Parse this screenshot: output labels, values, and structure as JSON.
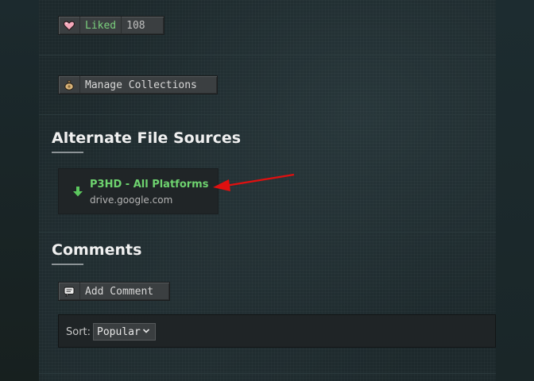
{
  "actions": {
    "liked_label": "Liked",
    "liked_count": "108",
    "collections_label": "Manage Collections"
  },
  "alt_sources": {
    "heading": "Alternate File Sources",
    "items": [
      {
        "title": "P3HD - All Platforms",
        "host": "drive.google.com"
      }
    ]
  },
  "comments": {
    "heading": "Comments",
    "add_label": "Add Comment",
    "sort_label": "Sort:",
    "sort_value": "Popular"
  },
  "colors": {
    "accent_green": "#6ed36f",
    "annotation_red": "#e01010",
    "page_bg": "#1a2529"
  },
  "icons": {
    "liked": "heart-icon",
    "collections": "bag-icon",
    "download": "download-arrow-icon",
    "comment": "speech-bubble-icon",
    "dropdown": "chevron-down-icon"
  }
}
